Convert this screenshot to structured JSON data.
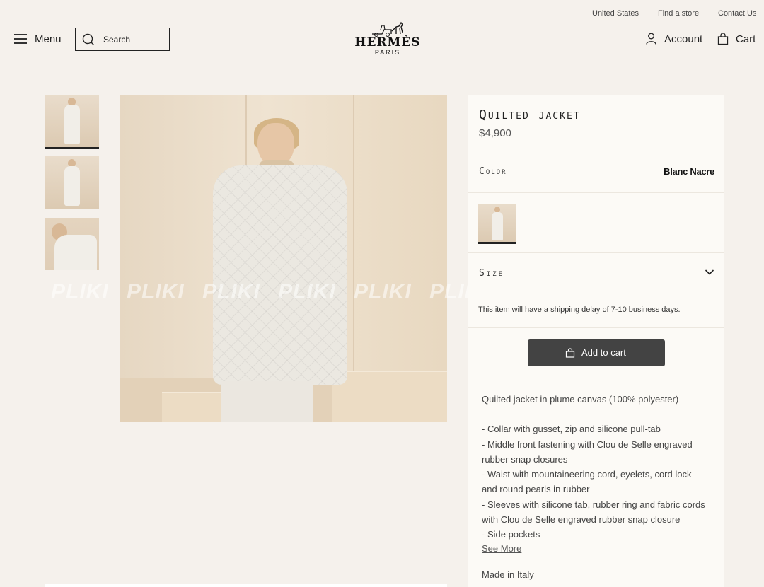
{
  "utility_links": [
    "United States",
    "Find a store",
    "Contact Us"
  ],
  "header": {
    "menu_label": "Menu",
    "search_label": "Search",
    "logo_word": "HERMÈS",
    "logo_sub": "PARIS",
    "account_label": "Account",
    "cart_label": "Cart"
  },
  "watermark": [
    "PLIKI",
    "PLIKI",
    "PLIKI",
    "PLIKI",
    "PLIKI",
    "PLIKI"
  ],
  "product": {
    "title": "Quilted jacket",
    "price": "$4,900",
    "color_label": "Color",
    "color_value": "Blanc Nacre",
    "size_label": "Size",
    "shipping_note": "This item will have a shipping delay of 7-10 business days.",
    "add_to_cart": "Add to cart",
    "description_intro": "Quilted jacket in plume canvas (100% polyester)",
    "description_lines": [
      "- Collar with gusset, zip and silicone pull-tab",
      "- Middle front fastening with Clou de Selle engraved",
      "rubber snap closures",
      "- Waist with mountaineering cord, eyelets, cord lock",
      "and round pearls in rubber",
      "- Sleeves with silicone tab, rubber ring and fabric cords",
      "with Clou de Selle engraved rubber snap closure",
      "- Side pockets"
    ],
    "see_more": "See More",
    "made_in": "Made in Italy"
  }
}
